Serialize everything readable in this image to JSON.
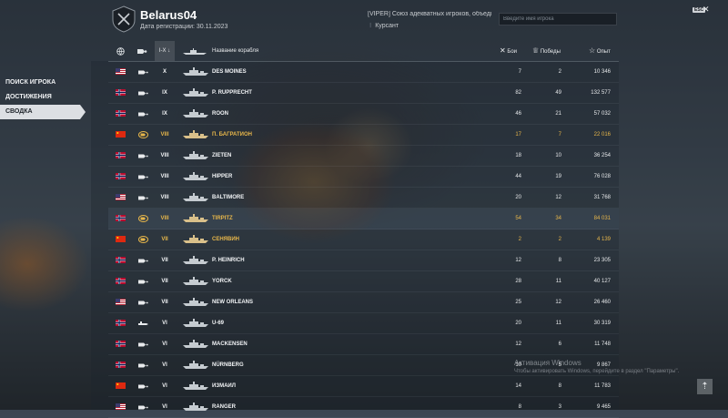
{
  "header": {
    "player_name": "Belarus04",
    "reg_date": "Дата регистрации: 30.11.2023",
    "clan_name": "[VIPER] Союз адекватных игроков, объединивш",
    "clan_role": "Курсант",
    "search_placeholder": "Введите имя игрока",
    "esc_label": "ESC",
    "close_glyph": "✕"
  },
  "sidebar": {
    "items": [
      {
        "label": "ПОИСК ИГРОКА",
        "active": false
      },
      {
        "label": "ДОСТИЖЕНИЯ",
        "active": false
      },
      {
        "label": "СВОДКА",
        "active": true
      }
    ]
  },
  "table": {
    "columns": {
      "nation_icon": "globe-icon",
      "class_icon": "ship-class-icon",
      "tier_filter": "I-X",
      "ship_name": "Название корабля",
      "battles": "Бои",
      "wins": "Победы",
      "exp": "Опыт"
    },
    "rows": [
      {
        "nation": "usa",
        "tier": "X",
        "name": "DES MOINES",
        "battles": "7",
        "wins": "2",
        "exp": "10 346",
        "premium": false
      },
      {
        "nation": "norway",
        "tier": "IX",
        "name": "P. RUPPRECHT",
        "battles": "82",
        "wins": "49",
        "exp": "132 577",
        "premium": false
      },
      {
        "nation": "norway",
        "tier": "IX",
        "name": "ROON",
        "battles": "46",
        "wins": "21",
        "exp": "57 032",
        "premium": false
      },
      {
        "nation": "china",
        "tier": "VIII",
        "name": "П. БАГРАТИОН",
        "battles": "17",
        "wins": "7",
        "exp": "22 016",
        "premium": true
      },
      {
        "nation": "norway",
        "tier": "VIII",
        "name": "ZIETEN",
        "battles": "18",
        "wins": "10",
        "exp": "36 254",
        "premium": false
      },
      {
        "nation": "norway",
        "tier": "VIII",
        "name": "HIPPER",
        "battles": "44",
        "wins": "19",
        "exp": "76 028",
        "premium": false
      },
      {
        "nation": "usa",
        "tier": "VIII",
        "name": "BALTIMORE",
        "battles": "20",
        "wins": "12",
        "exp": "31 768",
        "premium": false
      },
      {
        "nation": "norway",
        "tier": "VIII",
        "name": "TIRPITZ",
        "battles": "54",
        "wins": "34",
        "exp": "84 031",
        "premium": true,
        "highlight": true
      },
      {
        "nation": "china",
        "tier": "VII",
        "name": "СЕНЯВИН",
        "battles": "2",
        "wins": "2",
        "exp": "4 139",
        "premium": true
      },
      {
        "nation": "norway",
        "tier": "VII",
        "name": "P. HEINRICH",
        "battles": "12",
        "wins": "8",
        "exp": "23 305",
        "premium": false
      },
      {
        "nation": "norway",
        "tier": "VII",
        "name": "YORCK",
        "battles": "28",
        "wins": "11",
        "exp": "40 127",
        "premium": false
      },
      {
        "nation": "usa",
        "tier": "VII",
        "name": "NEW ORLEANS",
        "battles": "25",
        "wins": "12",
        "exp": "26 460",
        "premium": false
      },
      {
        "nation": "norway",
        "tier": "VI",
        "name": "U-69",
        "battles": "20",
        "wins": "11",
        "exp": "30 319",
        "premium": false,
        "submarine": true
      },
      {
        "nation": "norway",
        "tier": "VI",
        "name": "MACKENSEN",
        "battles": "12",
        "wins": "6",
        "exp": "11 748",
        "premium": false
      },
      {
        "nation": "norway",
        "tier": "VI",
        "name": "NÜRNBERG",
        "battles": "10",
        "wins": "5",
        "exp": "9 867",
        "premium": false
      },
      {
        "nation": "china",
        "tier": "VI",
        "name": "ИЗМАИЛ",
        "battles": "14",
        "wins": "8",
        "exp": "11 783",
        "premium": false
      },
      {
        "nation": "usa",
        "tier": "VI",
        "name": "RANGER",
        "battles": "8",
        "wins": "3",
        "exp": "9 465",
        "premium": false
      }
    ]
  },
  "watermark": {
    "title": "Активация Windows",
    "subtitle": "Чтобы активировать Windows, перейдите в раздел \"Параметры\"."
  },
  "scroll_top_glyph": "⇡",
  "colors": {
    "premium_text": "#e7b64a",
    "active_nav_bg": "#ebeef1"
  }
}
